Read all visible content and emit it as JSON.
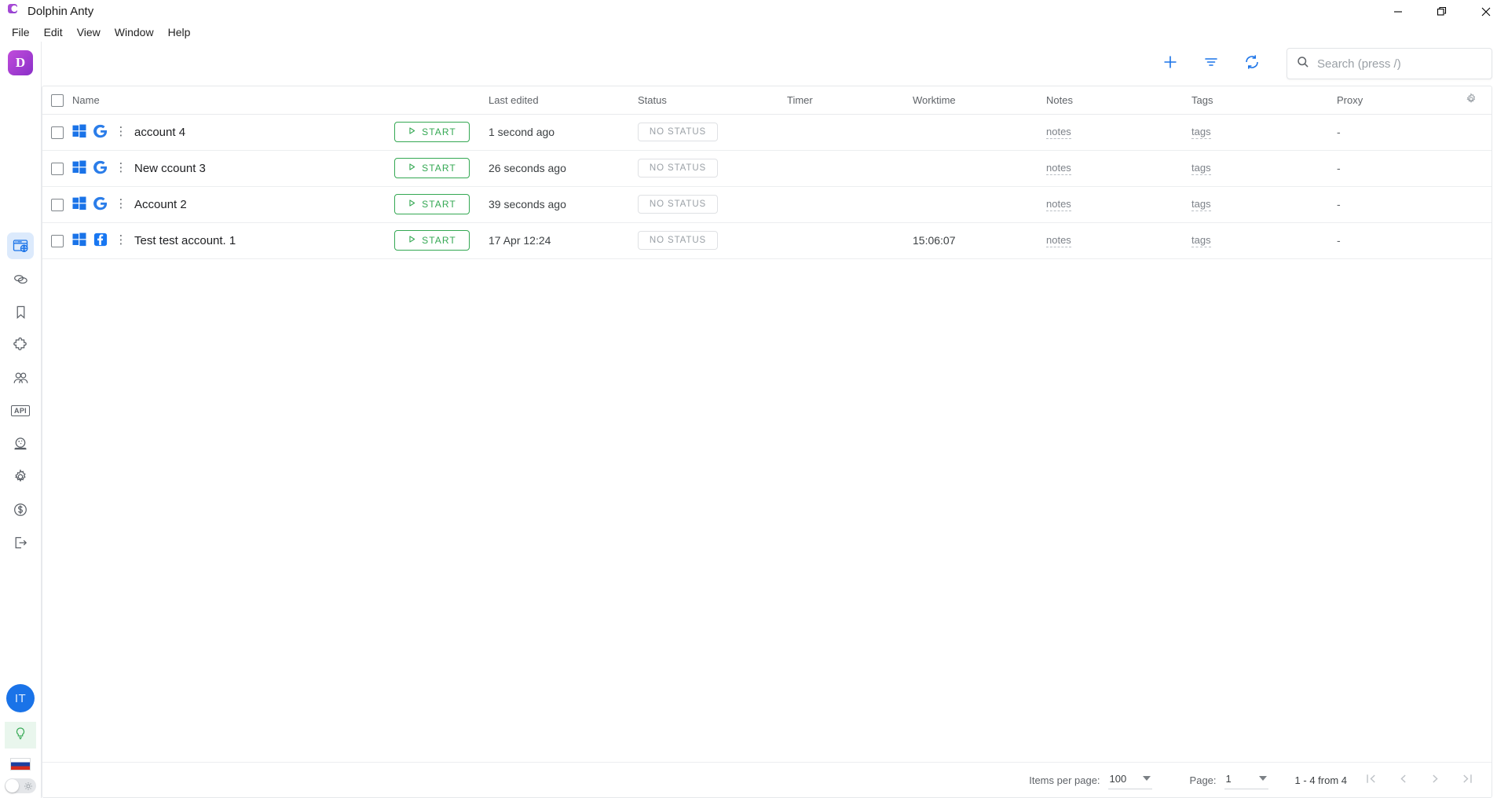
{
  "window": {
    "title": "Dolphin Anty",
    "logo_icon": "dolphin-logo-icon",
    "minimize_label": "Minimize",
    "maximize_label": "Restore",
    "close_label": "Close"
  },
  "menubar": {
    "items": [
      {
        "label": "File"
      },
      {
        "label": "Edit"
      },
      {
        "label": "View"
      },
      {
        "label": "Window"
      },
      {
        "label": "Help"
      }
    ]
  },
  "rail": {
    "logo_letter": "D",
    "items": [
      {
        "name": "browser-profiles",
        "icon": "browser-window-globe-icon",
        "active": true
      },
      {
        "name": "sync",
        "icon": "chain-links-icon",
        "active": false
      },
      {
        "name": "bookmarks",
        "icon": "bookmark-icon",
        "active": false
      },
      {
        "name": "extensions",
        "icon": "puzzle-piece-icon",
        "active": false
      },
      {
        "name": "team",
        "icon": "users-group-icon",
        "active": false
      },
      {
        "name": "api",
        "icon": "api-icon",
        "label": "API",
        "active": false
      },
      {
        "name": "automation",
        "icon": "crystal-ball-icon",
        "active": false
      },
      {
        "name": "settings",
        "icon": "gear-icon",
        "active": false
      },
      {
        "name": "billing",
        "icon": "dollar-circle-icon",
        "active": false
      },
      {
        "name": "logout",
        "icon": "logout-arrow-icon",
        "active": false
      }
    ],
    "avatar_initials": "IT",
    "tips_icon": "lightbulb-icon",
    "language_flag": "russia-flag-icon",
    "theme_toggle_state": "light"
  },
  "toolbar": {
    "add_icon": "plus-icon",
    "filter_icon": "filter-icon",
    "refresh_icon": "refresh-icon",
    "search": {
      "icon": "search-icon",
      "value": "",
      "placeholder": "Search (press /)"
    }
  },
  "table": {
    "columns": [
      {
        "key": "check",
        "label": ""
      },
      {
        "key": "name",
        "label": "Name"
      },
      {
        "key": "start",
        "label": ""
      },
      {
        "key": "edited",
        "label": "Last edited"
      },
      {
        "key": "status",
        "label": "Status"
      },
      {
        "key": "timer",
        "label": "Timer"
      },
      {
        "key": "work",
        "label": "Worktime"
      },
      {
        "key": "notes",
        "label": "Notes"
      },
      {
        "key": "tags",
        "label": "Tags"
      },
      {
        "key": "proxy",
        "label": "Proxy"
      },
      {
        "key": "gear",
        "label": ""
      }
    ],
    "settings_icon": "gear-icon",
    "start_label": "START",
    "start_icon": "play-icon",
    "rows": [
      {
        "os": "windows-icon",
        "brand": "google-icon",
        "menu_icon": "kebab-menu-icon",
        "name": "account 4",
        "edited": "1 second ago",
        "status": "NO STATUS",
        "timer": "",
        "worktime": "",
        "notes": "notes",
        "tags": "tags",
        "proxy": "-"
      },
      {
        "os": "windows-icon",
        "brand": "google-icon",
        "menu_icon": "kebab-menu-icon",
        "name": "New ccount 3",
        "edited": "26 seconds ago",
        "status": "NO STATUS",
        "timer": "",
        "worktime": "",
        "notes": "notes",
        "tags": "tags",
        "proxy": "-"
      },
      {
        "os": "windows-icon",
        "brand": "google-icon",
        "menu_icon": "kebab-menu-icon",
        "name": "Account 2",
        "edited": "39 seconds ago",
        "status": "NO STATUS",
        "timer": "",
        "worktime": "",
        "notes": "notes",
        "tags": "tags",
        "proxy": "-"
      },
      {
        "os": "windows-icon",
        "brand": "facebook-icon",
        "menu_icon": "kebab-menu-icon",
        "name": "Test test account. 1",
        "edited": "17 Apr 12:24",
        "status": "NO STATUS",
        "timer": "",
        "worktime": "15:06:07",
        "notes": "notes",
        "tags": "tags",
        "proxy": "-"
      }
    ]
  },
  "pagination": {
    "items_per_page_label": "Items per page:",
    "items_per_page_value": "100",
    "page_label": "Page:",
    "page_value": "1",
    "range_text": "1 - 4 from 4",
    "first_icon": "first-page-icon",
    "prev_icon": "prev-page-icon",
    "next_icon": "next-page-icon",
    "last_icon": "last-page-icon"
  },
  "colors": {
    "accent": "#1a73e8",
    "start_green": "#34a853",
    "logo_purple": "#a63bd4",
    "muted": "#9aa0a6"
  }
}
